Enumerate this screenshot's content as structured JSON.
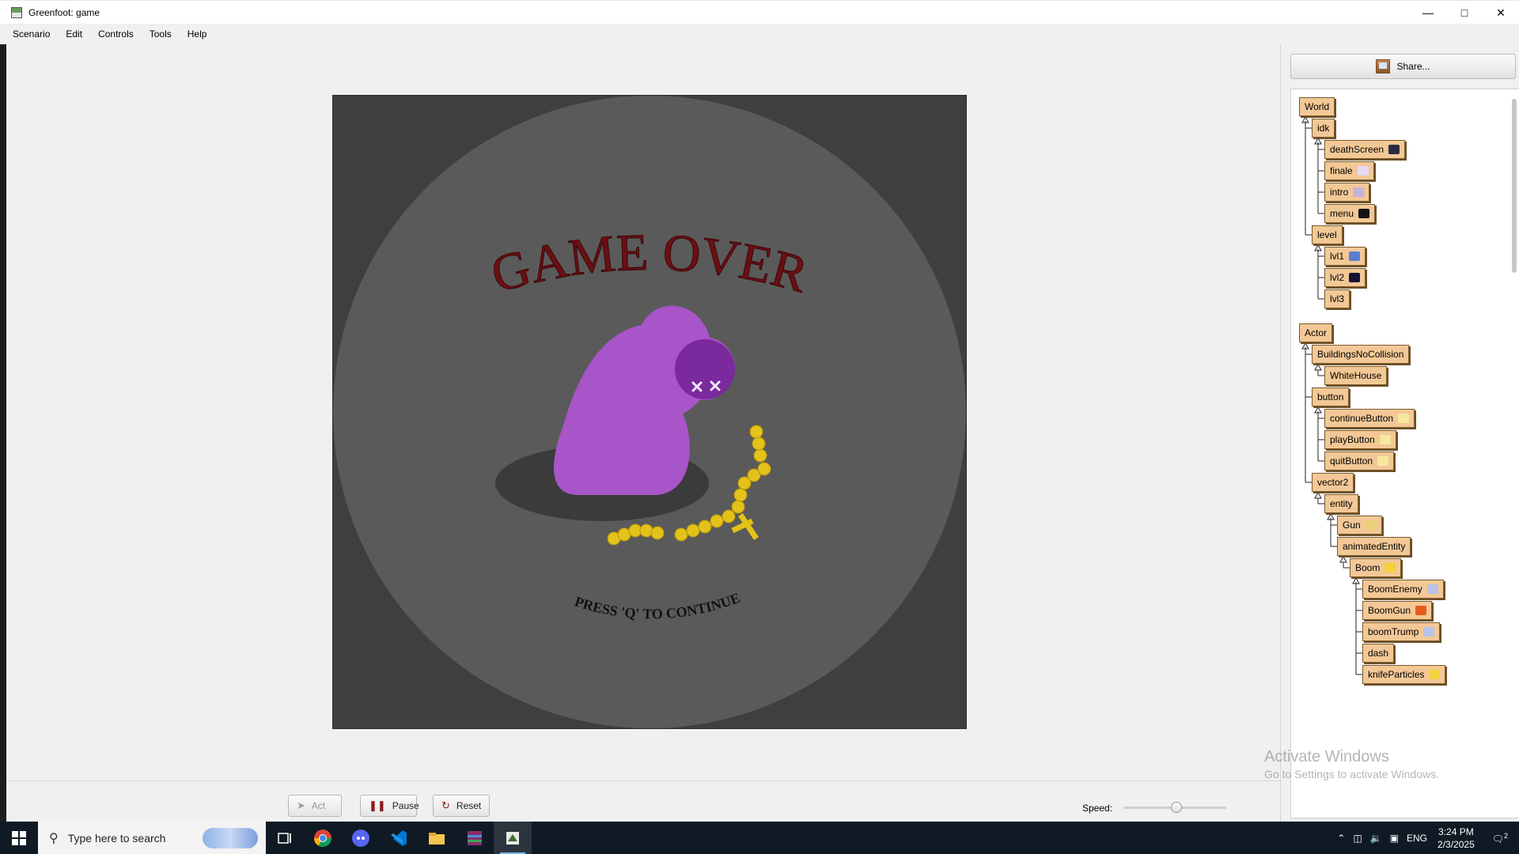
{
  "window": {
    "title": "Greenfoot: game"
  },
  "menus": [
    "Scenario",
    "Edit",
    "Controls",
    "Tools",
    "Help"
  ],
  "game": {
    "title_text": "GAME OVER",
    "prompt_text": "PRESS 'Q' TO CONTINUE",
    "colors": {
      "background": "#3f3f3f",
      "circle": "#5a5a5a",
      "title": "#6b0f14",
      "blob": "#a855c9",
      "eye": "#7a2a9c",
      "chain": "#e3c21a"
    }
  },
  "controls": {
    "act": "Act",
    "pause": "Pause",
    "reset": "Reset",
    "speed_label": "Speed:",
    "speed_value": 0.52
  },
  "share": {
    "label": "Share..."
  },
  "class_tree": {
    "world": [
      {
        "name": "World",
        "depth": 0
      },
      {
        "name": "idk",
        "depth": 1
      },
      {
        "name": "deathScreen",
        "depth": 2,
        "thumb": "#2b2b40"
      },
      {
        "name": "finale",
        "depth": 2,
        "thumb": "#e7d8f3"
      },
      {
        "name": "intro",
        "depth": 2,
        "thumb": "#c7b1dd"
      },
      {
        "name": "menu",
        "depth": 2,
        "thumb": "#111111"
      },
      {
        "name": "level",
        "depth": 1
      },
      {
        "name": "lvl1",
        "depth": 2,
        "thumb": "#5a7fd0"
      },
      {
        "name": "lvl2",
        "depth": 2,
        "thumb": "#141233"
      },
      {
        "name": "lvl3",
        "depth": 2
      }
    ],
    "actor": [
      {
        "name": "Actor",
        "depth": 0
      },
      {
        "name": "BuildingsNoCollision",
        "depth": 1
      },
      {
        "name": "WhiteHouse",
        "depth": 2
      },
      {
        "name": "button",
        "depth": 1
      },
      {
        "name": "continueButton",
        "depth": 2,
        "thumb": "#f7e7a0"
      },
      {
        "name": "playButton",
        "depth": 2,
        "thumb": "#f7e7a0"
      },
      {
        "name": "quitButton",
        "depth": 2,
        "thumb": "#f7e7a0"
      },
      {
        "name": "vector2",
        "depth": 1
      },
      {
        "name": "entity",
        "depth": 2
      },
      {
        "name": "Gun",
        "depth": 3,
        "thumb": "#e9d17a"
      },
      {
        "name": "animatedEntity",
        "depth": 3
      },
      {
        "name": "Boom",
        "depth": 4,
        "thumb": "#f2d23b"
      },
      {
        "name": "BoomEnemy",
        "depth": 5,
        "thumb": "#b9c3e8"
      },
      {
        "name": "BoomGun",
        "depth": 5,
        "thumb": "#e55a1d"
      },
      {
        "name": "boomTrump",
        "depth": 5,
        "thumb": "#b9c3e8"
      },
      {
        "name": "dash",
        "depth": 5
      },
      {
        "name": "knifeParticles",
        "depth": 5,
        "thumb": "#f2d23b"
      }
    ]
  },
  "watermark": {
    "line1": "Activate Windows",
    "line2": "Go to Settings to activate Windows."
  },
  "taskbar": {
    "search_placeholder": "Type here to search",
    "icons": [
      "task-view-icon",
      "chrome-icon",
      "discord-icon",
      "vscode-icon",
      "file-explorer-icon",
      "winrar-icon",
      "greenfoot-icon"
    ],
    "language": "ENG",
    "time": "3:24 PM",
    "date": "2/3/2025",
    "notifications": "2"
  }
}
